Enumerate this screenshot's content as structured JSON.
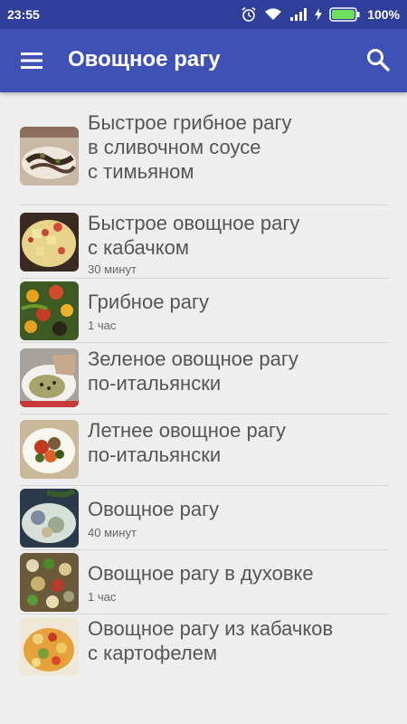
{
  "status": {
    "time": "23:55",
    "battery": "100%",
    "icons": [
      "alarm-icon",
      "wifi-icon",
      "signal-icon",
      "charging-icon",
      "battery-icon"
    ]
  },
  "appbar": {
    "title": "Овощное рагу",
    "menu_icon": "hamburger-menu-icon",
    "search_icon": "search-icon",
    "color": "#3f51b5",
    "status_color": "#2f3f9a"
  },
  "recipes": [
    {
      "title": "Быстрое грибное рагу\nв сливочном соусе\nс тимьяном",
      "meta": ""
    },
    {
      "title": "Быстрое овощное рагу\nс кабачком",
      "meta": "30 минут"
    },
    {
      "title": "Грибное рагу",
      "meta": "1 час"
    },
    {
      "title": "Зеленое овощное рагу\nпо-итальянски",
      "meta": ""
    },
    {
      "title": "Летнее овощное рагу\nпо-итальянски",
      "meta": ""
    },
    {
      "title": "Овощное рагу",
      "meta": "40 минут"
    },
    {
      "title": "Овощное рагу в духовке",
      "meta": "1 час"
    },
    {
      "title": "Овощное рагу из кабачков\nс картофелем",
      "meta": ""
    }
  ]
}
